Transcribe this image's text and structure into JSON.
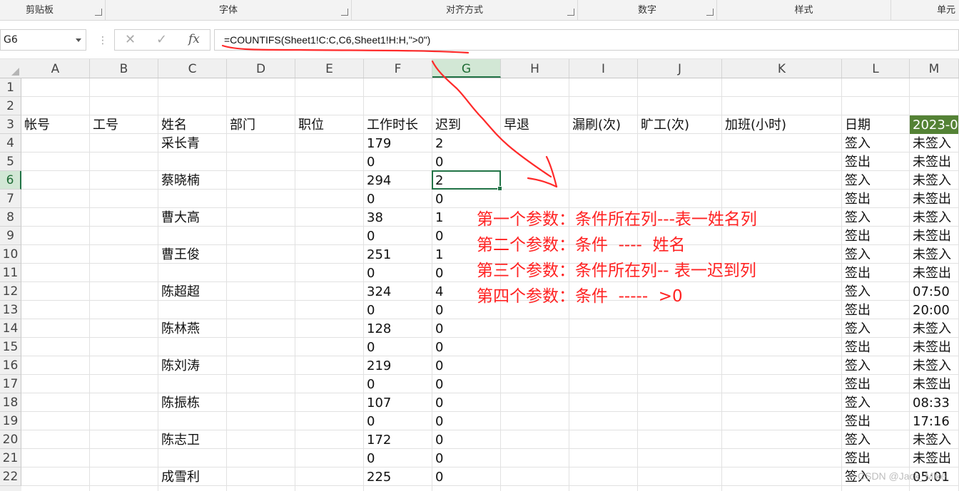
{
  "ribbon": {
    "groups": [
      {
        "label": "剪贴板"
      },
      {
        "label": "字体"
      },
      {
        "label": "对齐方式"
      },
      {
        "label": "数字"
      },
      {
        "label": "样式"
      },
      {
        "label": "单元"
      }
    ]
  },
  "formula_bar": {
    "name_box": "G6",
    "cancel_icon": "✕",
    "enter_icon": "✓",
    "fx_label": "fx",
    "formula": "=COUNTIFS(Sheet1!C:C,C6,Sheet1!H:H,\">0\")"
  },
  "columns": [
    "A",
    "B",
    "C",
    "D",
    "E",
    "F",
    "G",
    "H",
    "I",
    "J",
    "K",
    "L",
    "M"
  ],
  "selected_column": "G",
  "selected_row": "6",
  "rows": [
    "1",
    "2",
    "3",
    "4",
    "5",
    "6",
    "7",
    "8",
    "9",
    "10",
    "11",
    "12",
    "13",
    "14",
    "15",
    "16",
    "17",
    "18",
    "19",
    "20",
    "21",
    "22"
  ],
  "header_row": {
    "A": "帐号",
    "B": "工号",
    "C": "姓名",
    "D": "部门",
    "E": "职位",
    "F": "工作时长",
    "G": "迟到",
    "H": "早退",
    "I": "漏刷(次)",
    "J": "旷工(次)",
    "K": "加班(小时)",
    "L": "日期",
    "M": "2023-0"
  },
  "data_rows": [
    {
      "C": "采长青",
      "F": "179",
      "G": "2",
      "L": "签入",
      "M": "未签入"
    },
    {
      "C": "",
      "F": "0",
      "G": "0",
      "L": "签出",
      "M": "未签出"
    },
    {
      "C": "蔡晓楠",
      "F": "294",
      "G": "2",
      "L": "签入",
      "M": "未签入"
    },
    {
      "C": "",
      "F": "0",
      "G": "0",
      "L": "签出",
      "M": "未签出"
    },
    {
      "C": "曹大高",
      "F": "38",
      "G": "1",
      "L": "签入",
      "M": "未签入"
    },
    {
      "C": "",
      "F": "0",
      "G": "0",
      "L": "签出",
      "M": "未签出"
    },
    {
      "C": "曹王俊",
      "F": "251",
      "G": "1",
      "L": "签入",
      "M": "未签入"
    },
    {
      "C": "",
      "F": "0",
      "G": "0",
      "L": "签出",
      "M": "未签出"
    },
    {
      "C": "陈超超",
      "F": "324",
      "G": "4",
      "L": "签入",
      "M": "07:50"
    },
    {
      "C": "",
      "F": "0",
      "G": "0",
      "L": "签出",
      "M": "20:00"
    },
    {
      "C": "陈林燕",
      "F": "128",
      "G": "0",
      "L": "签入",
      "M": "未签入"
    },
    {
      "C": "",
      "F": "0",
      "G": "0",
      "L": "签出",
      "M": "未签出"
    },
    {
      "C": "陈刘涛",
      "F": "219",
      "G": "0",
      "L": "签入",
      "M": "未签入"
    },
    {
      "C": "",
      "F": "0",
      "G": "0",
      "L": "签出",
      "M": "未签出"
    },
    {
      "C": "陈振栋",
      "F": "107",
      "G": "0",
      "L": "签入",
      "M": "08:33"
    },
    {
      "C": "",
      "F": "0",
      "G": "0",
      "L": "签出",
      "M": "17:16"
    },
    {
      "C": "陈志卫",
      "F": "172",
      "G": "0",
      "L": "签入",
      "M": "未签入"
    },
    {
      "C": "",
      "F": "0",
      "G": "0",
      "L": "签出",
      "M": "未签出"
    },
    {
      "C": "成雪利",
      "F": "225",
      "G": "0",
      "L": "签入",
      "M": "05:01"
    }
  ],
  "annotation": {
    "lines": [
      "第一个参数：条件所在列---表一姓名列",
      "第二个参数：条件  ----  姓名",
      "第三个参数：条件所在列-- 表一迟到列",
      "第四个参数：条件  -----  >0"
    ],
    "color": "#ff2222"
  },
  "watermark": "CSDN @Jack_Mike",
  "colors": {
    "excel_green": "#217346",
    "header_fill": "#548235",
    "annotation_red": "#ff2222"
  }
}
